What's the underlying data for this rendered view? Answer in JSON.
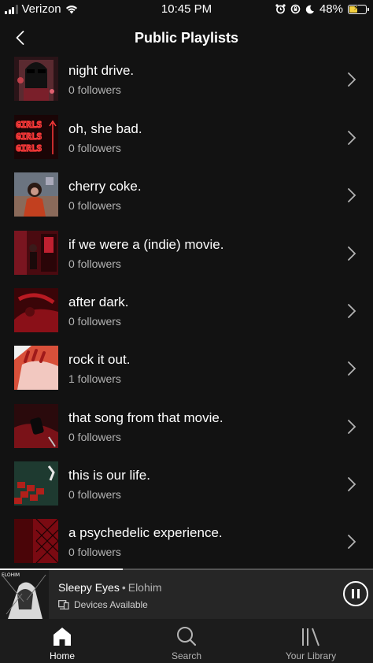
{
  "status_bar": {
    "carrier": "Verizon",
    "time": "10:45 PM",
    "battery": "48%",
    "battery_level": 0.48
  },
  "header": {
    "title": "Public Playlists",
    "back_icon": "chevron-left-icon"
  },
  "playlists": [
    {
      "title": "night drive.",
      "followers": "0 followers"
    },
    {
      "title": "oh, she bad.",
      "followers": "0 followers"
    },
    {
      "title": "cherry coke.",
      "followers": "0 followers"
    },
    {
      "title": "if we were a (indie) movie.",
      "followers": "0 followers"
    },
    {
      "title": "after dark.",
      "followers": "0 followers"
    },
    {
      "title": "rock it out.",
      "followers": "1 followers"
    },
    {
      "title": "that song from that movie.",
      "followers": "0 followers"
    },
    {
      "title": "this is our life.",
      "followers": "0 followers"
    },
    {
      "title": "a psychedelic experience.",
      "followers": "0 followers"
    }
  ],
  "thumb_text": {
    "girls": "GIRLS"
  },
  "player": {
    "track": "Sleepy Eyes",
    "separator": "•",
    "artist": "Elohim",
    "art_label": "ELOHIM",
    "devices": "Devices Available",
    "progress": 0.33
  },
  "tabs": [
    {
      "label": "Home",
      "icon": "home-icon",
      "active": true
    },
    {
      "label": "Search",
      "icon": "search-icon",
      "active": false
    },
    {
      "label": "Your Library",
      "icon": "library-icon",
      "active": false
    }
  ],
  "colors": {
    "background": "#121212",
    "player_bg": "#262626",
    "tabbar_bg": "#1c1c1c",
    "secondary_text": "#b3b3b3",
    "battery_fill": "#f4d03f"
  }
}
